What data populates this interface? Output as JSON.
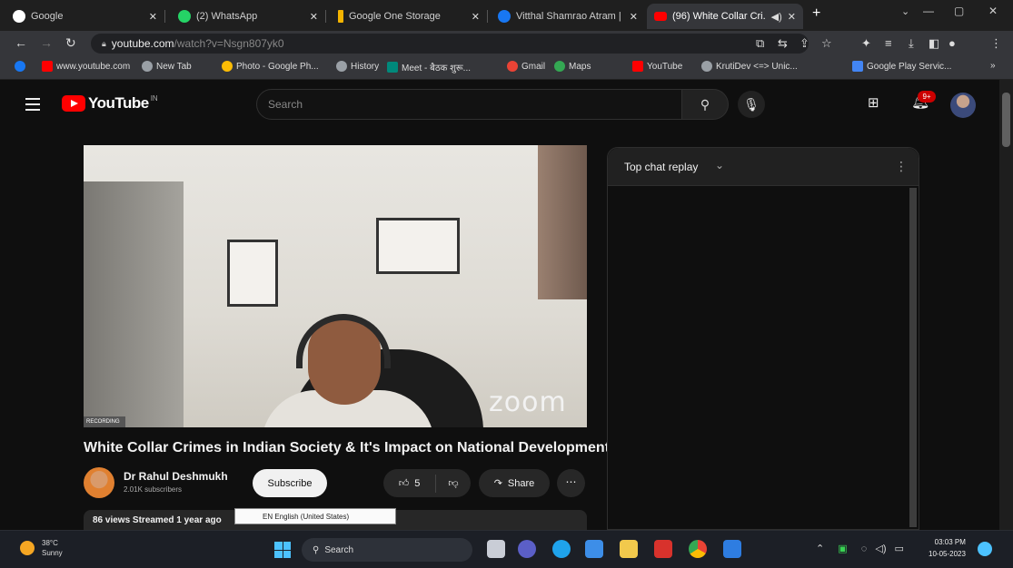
{
  "browser": {
    "tabs": [
      {
        "title": "Google",
        "favicon_color": "#ffffff",
        "active": false
      },
      {
        "title": "(2) WhatsApp",
        "favicon_color": "#25d366",
        "active": false
      },
      {
        "title": "Google One Storage",
        "favicon_color": "#f4b400",
        "active": false
      },
      {
        "title": "Vitthal Shamrao Atram | ...",
        "favicon_color": "#1877f2",
        "active": false
      },
      {
        "title": "(96) White Collar Cri...",
        "favicon_color": "#ff0000",
        "active": true
      }
    ],
    "new_tab_label": "+",
    "url_domain": "youtube.com",
    "url_path": "/watch?v=Nsgn807yk0",
    "bookmarks": [
      {
        "label": "www.youtube.com",
        "color": "#ff0000"
      },
      {
        "label": "New Tab",
        "color": "#9aa0a6"
      },
      {
        "label": "Photo - Google Ph...",
        "color": "#fbbc05"
      },
      {
        "label": "History",
        "color": "#9aa0a6"
      },
      {
        "label": "Meet - बैठक शुरू...",
        "color": "#00897b"
      },
      {
        "label": "Gmail",
        "color": "#ea4335"
      },
      {
        "label": "Maps",
        "color": "#34a853"
      },
      {
        "label": "YouTube",
        "color": "#ff0000"
      },
      {
        "label": "KrutiDev <=> Unic...",
        "color": "#9aa0a6"
      },
      {
        "label": "Google Play Servic...",
        "color": "#4285f4"
      }
    ]
  },
  "youtube": {
    "logo_text": "YouTube",
    "logo_country": "IN",
    "search_placeholder": "Search",
    "notification_count": "9+",
    "video": {
      "overlay_text": "zoom",
      "rec_badge": "RECORDING",
      "title": "White Collar Crimes in Indian Society & It's Impact on National Development"
    },
    "channel": {
      "name": "Dr Rahul Deshmukh",
      "subscribers": "2.01K subscribers",
      "subscribe_label": "Subscribe"
    },
    "actions": {
      "likes": "5",
      "share_label": "Share",
      "more_label": "⋯"
    },
    "description_meta": "86 views  Streamed 1 year ago",
    "language_popup": "EN English (United States)",
    "chat": {
      "title": "Top chat replay"
    }
  },
  "taskbar": {
    "temperature": "38°C",
    "weather": "Sunny",
    "search_label": "Search",
    "time": "03:03 PM",
    "date": "10-05-2023",
    "apps": [
      {
        "name": "file-manager",
        "color": "#c9cdd6"
      },
      {
        "name": "chat",
        "color": "#5b5fc7"
      },
      {
        "name": "edge",
        "color": "#1fa3ec"
      },
      {
        "name": "store",
        "color": "#3d8ee8"
      },
      {
        "name": "explorer",
        "color": "#f2c94c"
      },
      {
        "name": "wps",
        "color": "#d8322c"
      },
      {
        "name": "chrome",
        "color": "#fbbc05"
      },
      {
        "name": "photos",
        "color": "#2e7de1"
      }
    ]
  }
}
